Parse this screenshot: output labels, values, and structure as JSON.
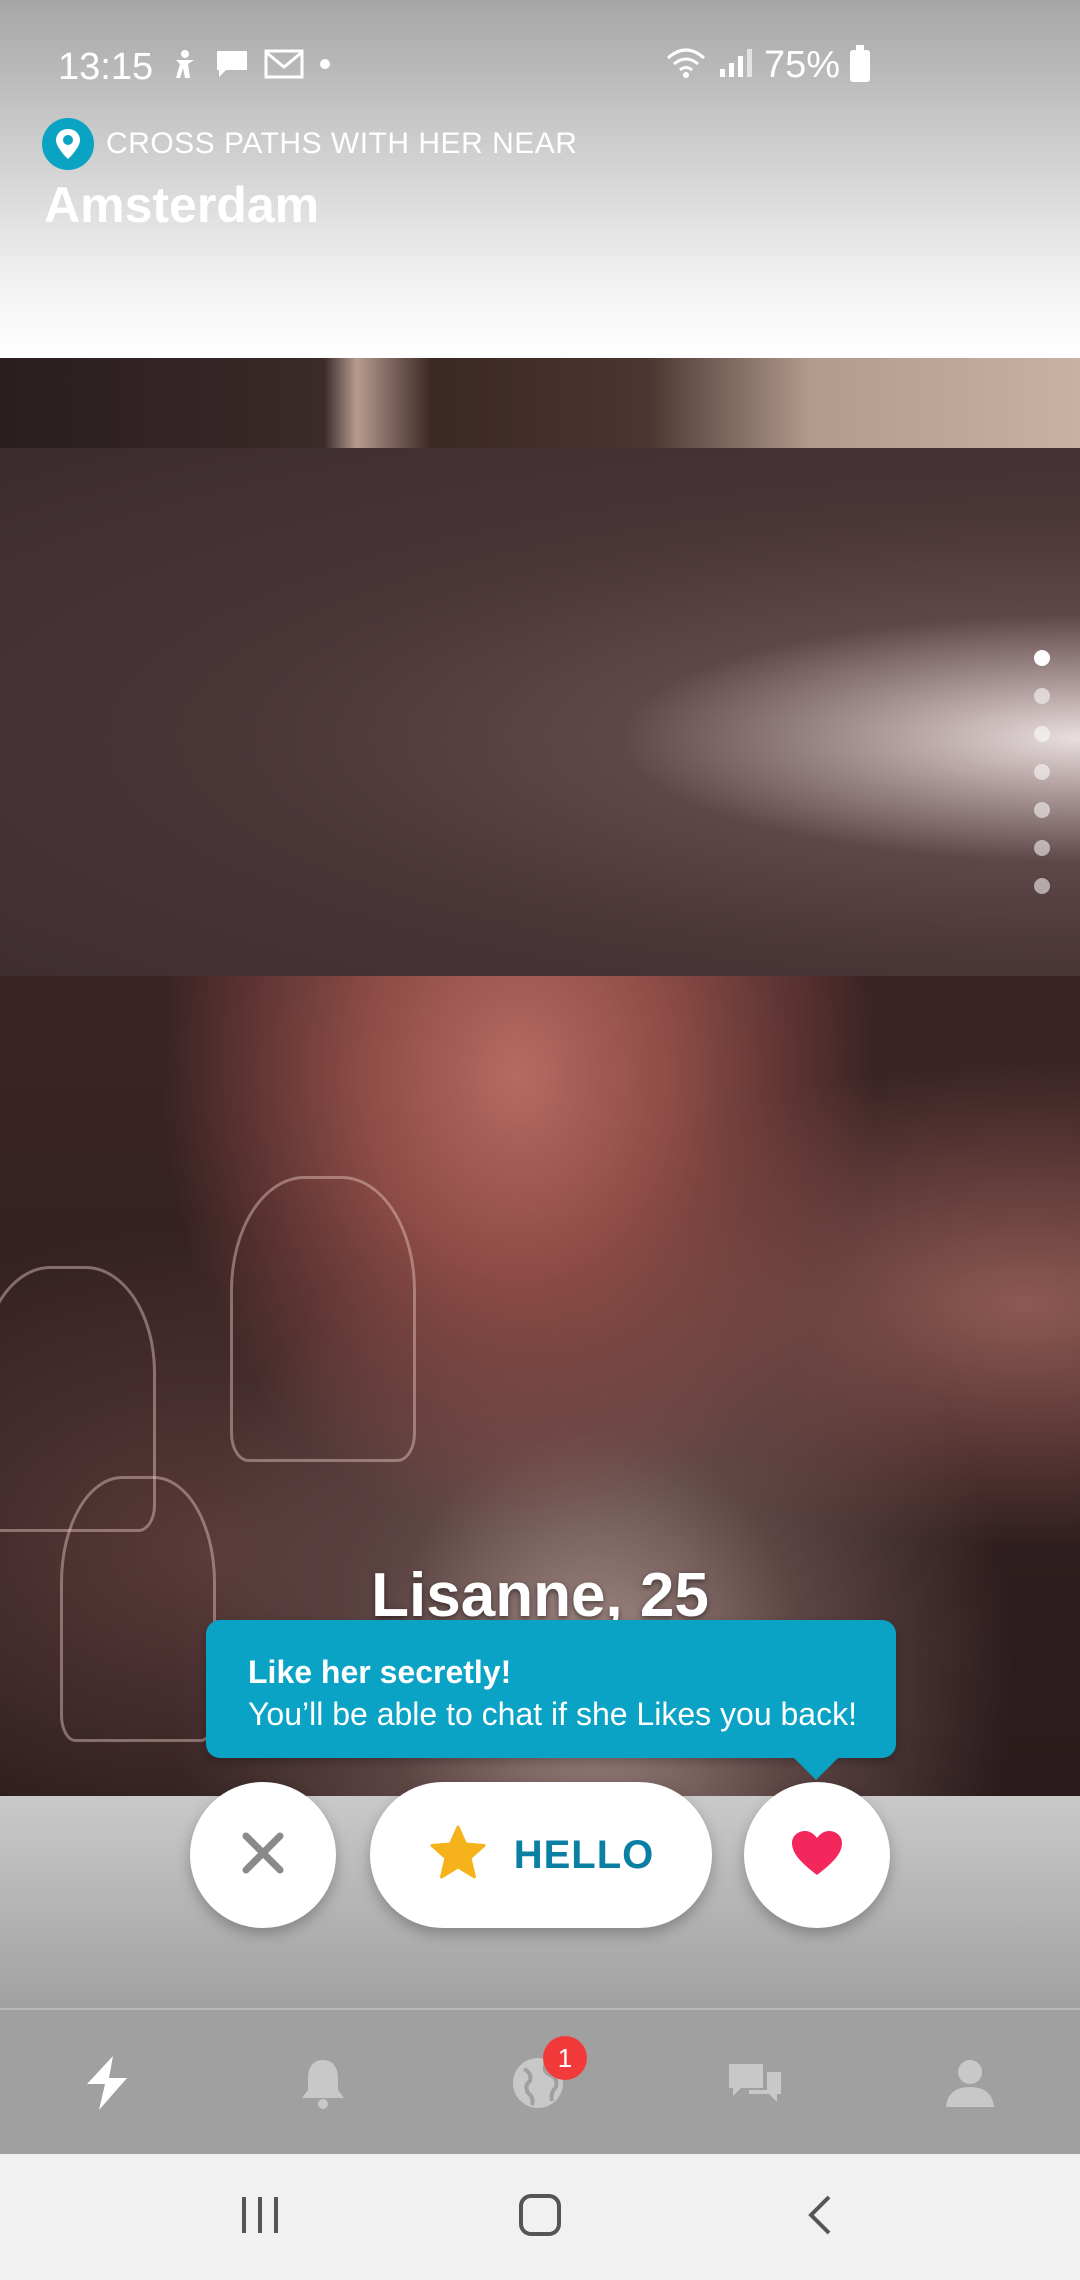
{
  "status_bar": {
    "time": "13:15",
    "battery": "75%",
    "icons": [
      "accessibility-icon",
      "message-icon",
      "gmail-icon",
      "dot-icon",
      "wifi-icon",
      "signal-icon",
      "battery-icon"
    ]
  },
  "header": {
    "location_label": "CROSS PATHS WITH HER NEAR",
    "city": "Amsterdam"
  },
  "profile": {
    "name_age": "Lisanne, 25",
    "photo_count": 7,
    "active_photo": 1
  },
  "tooltip": {
    "title": "Like her secretly!",
    "body": "You’ll be able to chat if she Likes you back!"
  },
  "actions": {
    "hello_label": "HELLO"
  },
  "bottom_nav": {
    "items": [
      "lightning-icon",
      "bell-icon",
      "globe-icon",
      "chat-icon",
      "profile-icon"
    ],
    "globe_badge": "1"
  },
  "colors": {
    "accent": "#0aa3c6",
    "hello_text": "#0a7fa4",
    "star": "#f5b21a",
    "heart": "#f3275c",
    "badge": "#f23a3a"
  }
}
